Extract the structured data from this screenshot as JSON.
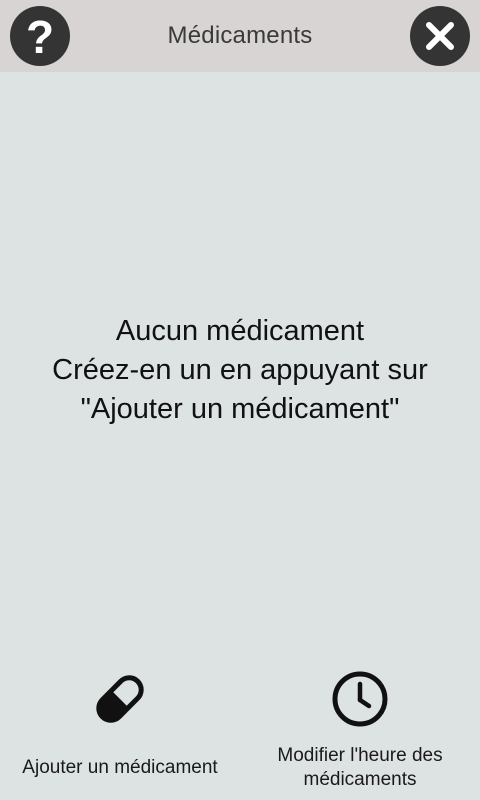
{
  "header": {
    "title": "Médicaments",
    "help_icon": "question-mark-icon",
    "close_icon": "close-icon",
    "background": "#d8d4d3"
  },
  "empty_state": {
    "line1": "Aucun médicament",
    "line2": "Créez-en un en appuyant sur",
    "line3": "\"Ajouter un médicament\""
  },
  "actions": {
    "add_label": "Ajouter un médicament",
    "add_icon": "pill-icon",
    "time_label_line1": "Modifier l'heure des",
    "time_label_line2": "médicaments",
    "time_icon": "clock-icon"
  },
  "colors": {
    "background": "#dde2e3",
    "icon_dark": "#343434"
  }
}
